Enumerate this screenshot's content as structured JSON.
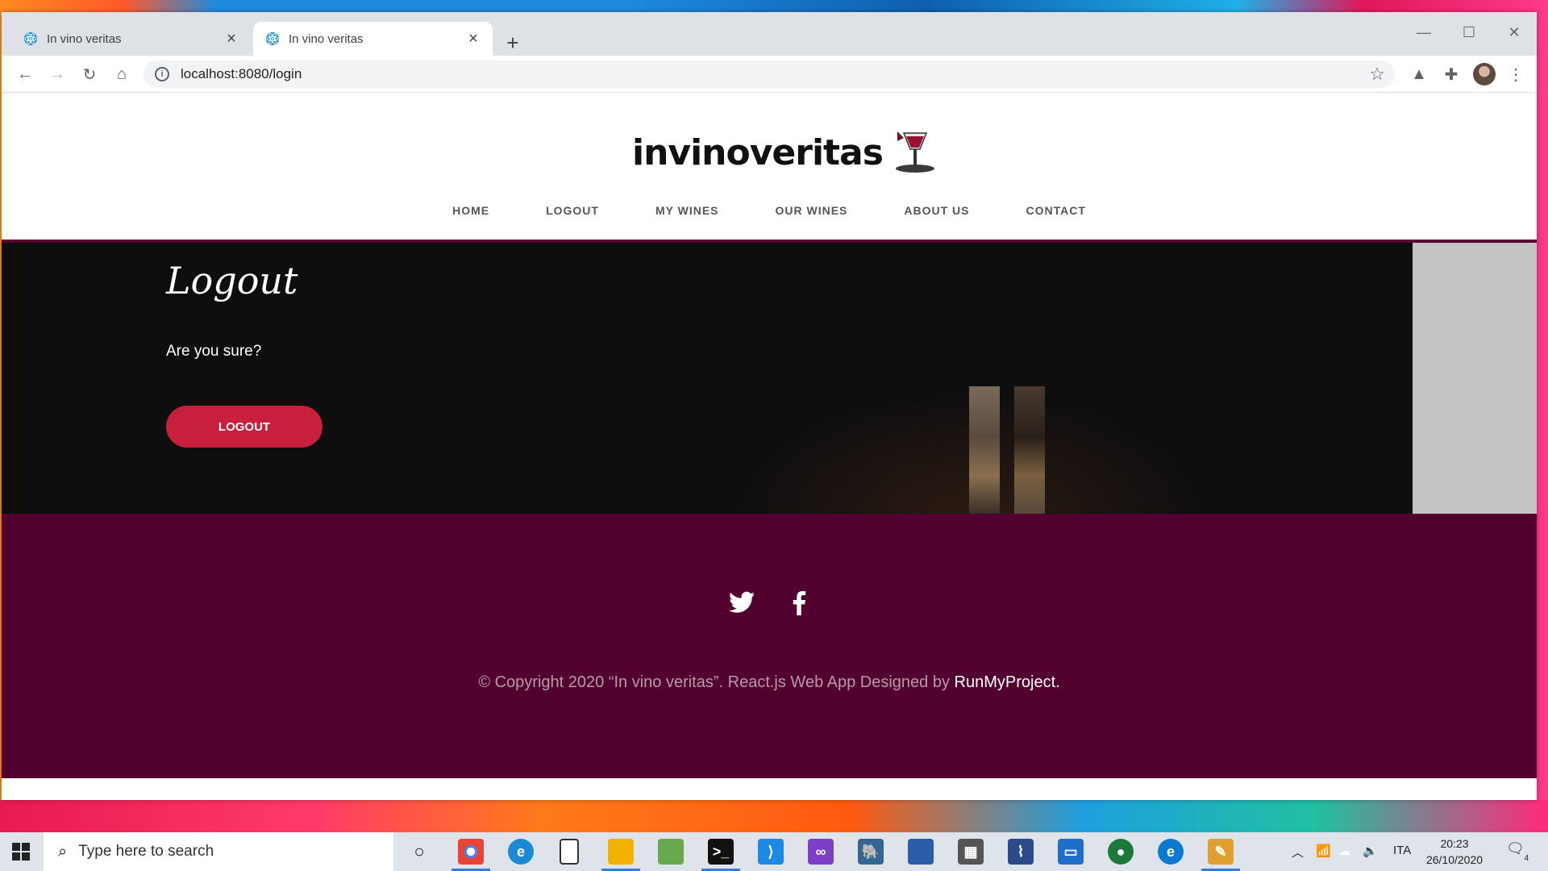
{
  "browser": {
    "tabs": [
      {
        "title": "In vino veritas",
        "active": false
      },
      {
        "title": "In vino veritas",
        "active": true
      }
    ],
    "url": "localhost:8080/login"
  },
  "site": {
    "logo_text": "invinoveritas",
    "nav": [
      "HOME",
      "LOGOUT",
      "MY WINES",
      "OUR WINES",
      "ABOUT US",
      "CONTACT"
    ],
    "hero": {
      "heading": "Logout",
      "prompt": "Are you sure?",
      "button": "LOGOUT"
    },
    "footer": {
      "copyright": "© Copyright 2020 “In vino veritas”. React.js Web App Designed by ",
      "brand": "RunMyProject."
    }
  },
  "taskbar": {
    "search_placeholder": "Type here to search",
    "language": "ITA",
    "time": "20:23",
    "date": "26/10/2020",
    "notification_count": "4"
  },
  "colors": {
    "accent_red": "#c8203c",
    "footer_bg": "#520030",
    "hero_bg": "#0e0e0f"
  }
}
